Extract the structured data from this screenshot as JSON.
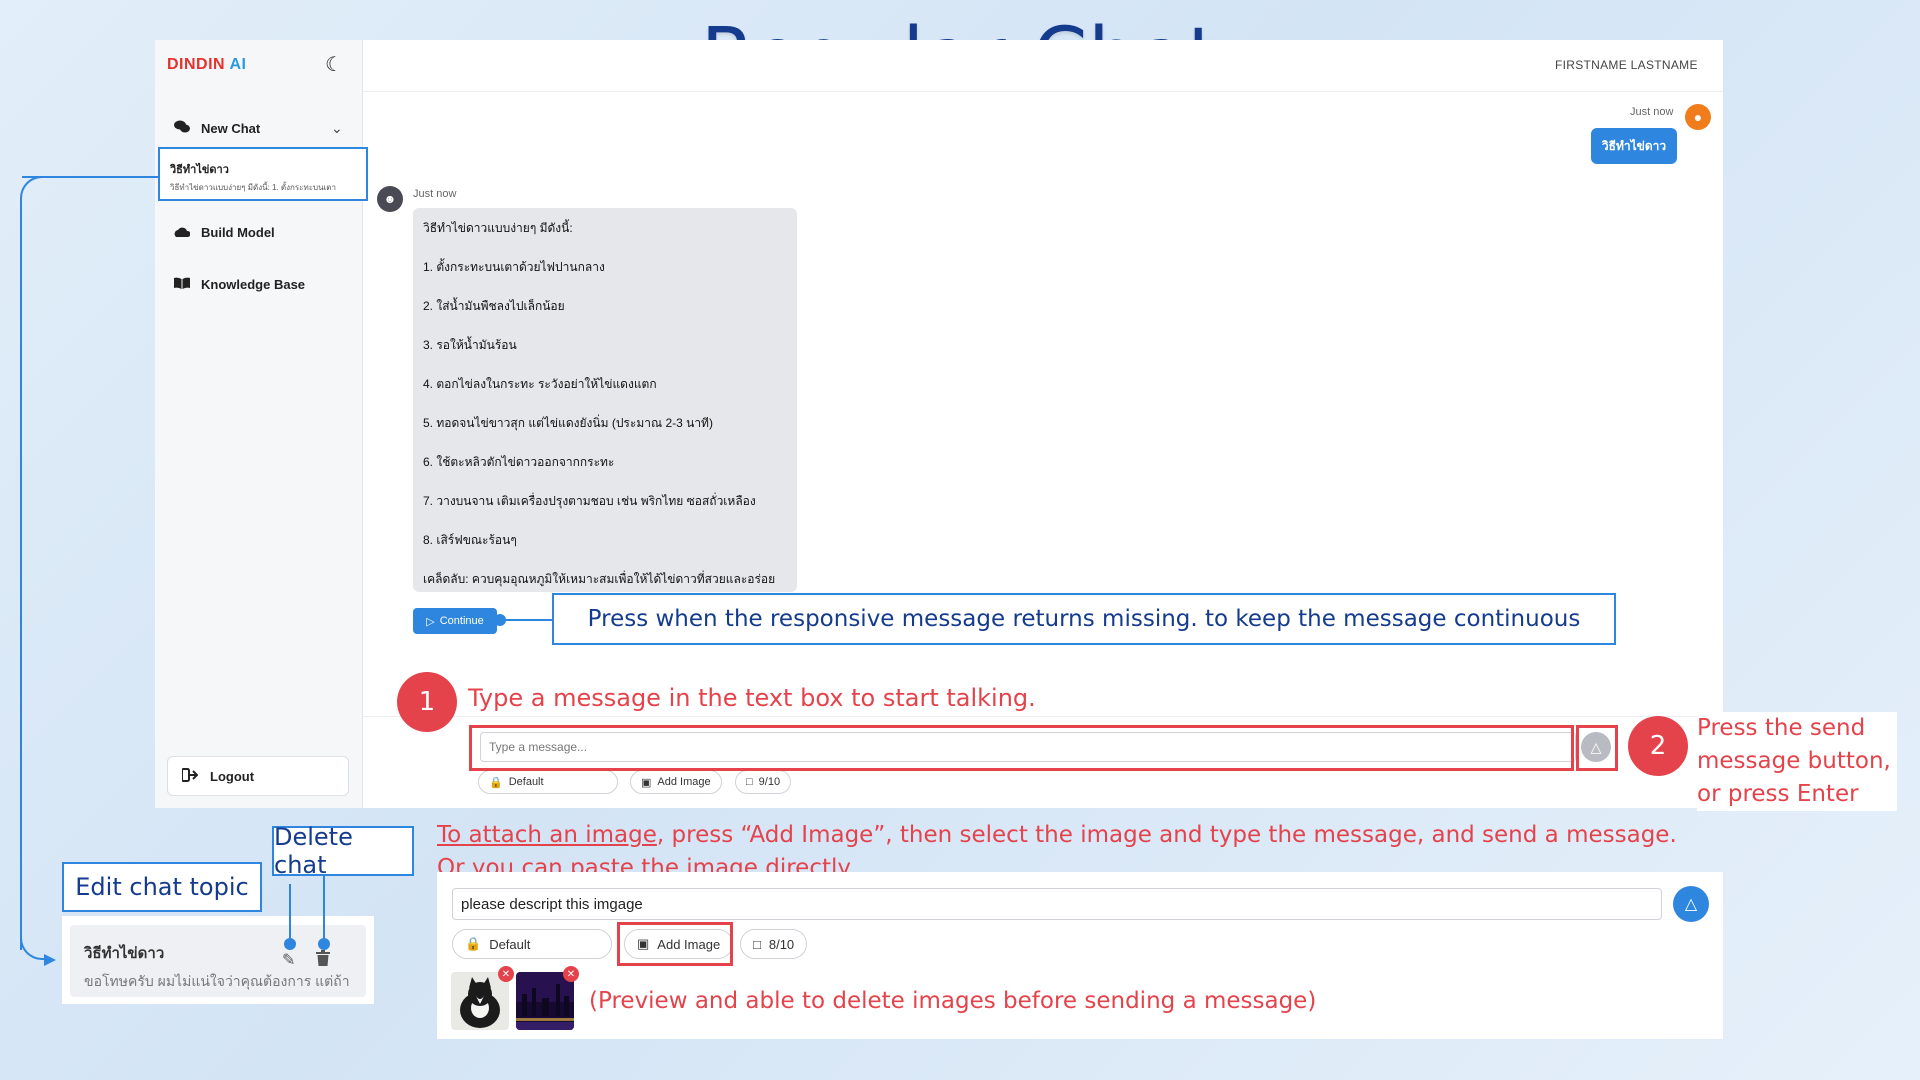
{
  "page_title": "Regular Chat",
  "app": {
    "logo_din": "DINDIN",
    "logo_ai": "AI",
    "username": "FIRSTNAME LASTNAME",
    "sidebar": {
      "new_chat": "New Chat",
      "selected_chat_title": "วิธีทำไข่ดาว",
      "selected_chat_snippet": "วิธีทำไข่ดาวแบบง่ายๆ มีดังนี้: 1. ตั้งกระทะบนเตา",
      "build_model": "Build Model",
      "knowledge_base": "Knowledge Base",
      "logout": "Logout"
    },
    "messages": {
      "user_time": "Just now",
      "user_text": "วิธีทำไข่ดาว",
      "bot_time": "Just now",
      "bot_lines": [
        "วิธีทำไข่ดาวแบบง่ายๆ มีดังนี้:",
        "1. ตั้งกระทะบนเตาด้วยไฟปานกลาง",
        "2. ใส่น้ำมันพืชลงไปเล็กน้อย",
        "3. รอให้น้ำมันร้อน",
        "4. ตอกไข่ลงในกระทะ ระวังอย่าให้ไข่แดงแตก",
        "5. ทอดจนไข่ขาวสุก แต่ไข่แดงยังนิ่ม (ประมาณ 2-3 นาที)",
        "6. ใช้ตะหลิวตักไข่ดาวออกจากกระทะ",
        "7. วางบนจาน เติมเครื่องปรุงตามชอบ เช่น พริกไทย ซอสถั่วเหลือง",
        "8. เสิร์ฟขณะร้อนๆ",
        "เคล็ดลับ: ควบคุมอุณหภูมิให้เหมาะสมเพื่อให้ได้ไข่ดาวที่สวยและอร่อย"
      ],
      "continue_label": "Continue"
    },
    "input": {
      "placeholder": "Type a message...",
      "model_chip": "Default",
      "add_image_chip": "Add Image",
      "counter_chip": "9/10"
    }
  },
  "annotations": {
    "continue_note": "Press when the responsive message returns missing. to keep the message continuous",
    "step1_number": "1",
    "step1_text": "Type a message in the text box to start talking.",
    "step2_number": "2",
    "step2_text_line1": "Press the send",
    "step2_text_line2": "message button,",
    "step2_text_line3": "or press Enter",
    "attach_link": "To attach an image",
    "attach_rest": ", press “Add Image”, then select the image and type the message, and send a message.",
    "attach_line2": "Or you can paste the image directly.",
    "preview_note": "(Preview and able to delete images before sending a message)",
    "edit_chat_topic": "Edit chat topic",
    "delete_chat": "Delete chat"
  },
  "demo": {
    "input_value": "please descript this imgage",
    "model_chip": "Default",
    "add_image_chip": "Add Image",
    "counter_chip": "8/10",
    "side_item_title": "วิธีทำไข่ดาว",
    "side_item_snippet": "ขอโทษครับ ผมไม่แน่ใจว่าคุณต้องการ แต่ถ้า"
  },
  "colors": {
    "accent_blue": "#2e86de",
    "annotation_red": "#e5434b",
    "title_navy": "#143b8e"
  }
}
